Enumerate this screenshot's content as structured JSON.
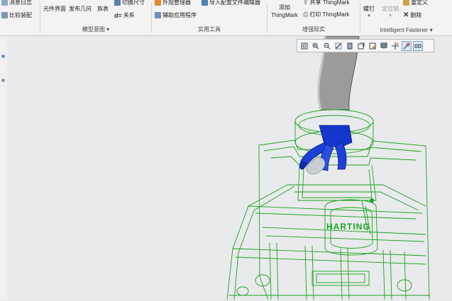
{
  "ribbon": {
    "left_items": [
      "消息日志",
      "比较装配"
    ],
    "model_intent": {
      "items": [
        "元件界面",
        "发布几何",
        "族表",
        "切换尺寸",
        "关系"
      ],
      "label": "模型意图"
    },
    "utilities": {
      "items": [
        "外观管理器",
        "辅助应用程序",
        "导入配置文件编辑器"
      ],
      "label": "实用工具"
    },
    "augmented_reality": {
      "add_line1": "添加",
      "add_line2": "ThingMark",
      "share": "共享 ThingMark",
      "print": "打印 ThingMark",
      "label": "增强现实"
    },
    "intelligent_fastener": {
      "screw_label": "螺钉",
      "locate_label": "定位销",
      "redefine": "重定义",
      "delete": "删除",
      "label": "Intelligent Fastener ▾",
      "dropdown_arrow": "▾"
    }
  },
  "viewport": {
    "model_logo_text": "HARTING",
    "view_toolbar_icons": [
      "refit-icon",
      "zoom-in-icon",
      "zoom-out-icon",
      "repaint-icon",
      "display-style-icon",
      "saved-orientations-icon",
      "view-manager-icon",
      "perspective-icon",
      "datum-display-icon",
      "spin-center-icon",
      "annotation-display-icon"
    ]
  },
  "colors": {
    "wireframe": "#1aa31a",
    "cable": "#9a9a9a",
    "gripper": "#1638d6",
    "background": "#e9eaec"
  }
}
